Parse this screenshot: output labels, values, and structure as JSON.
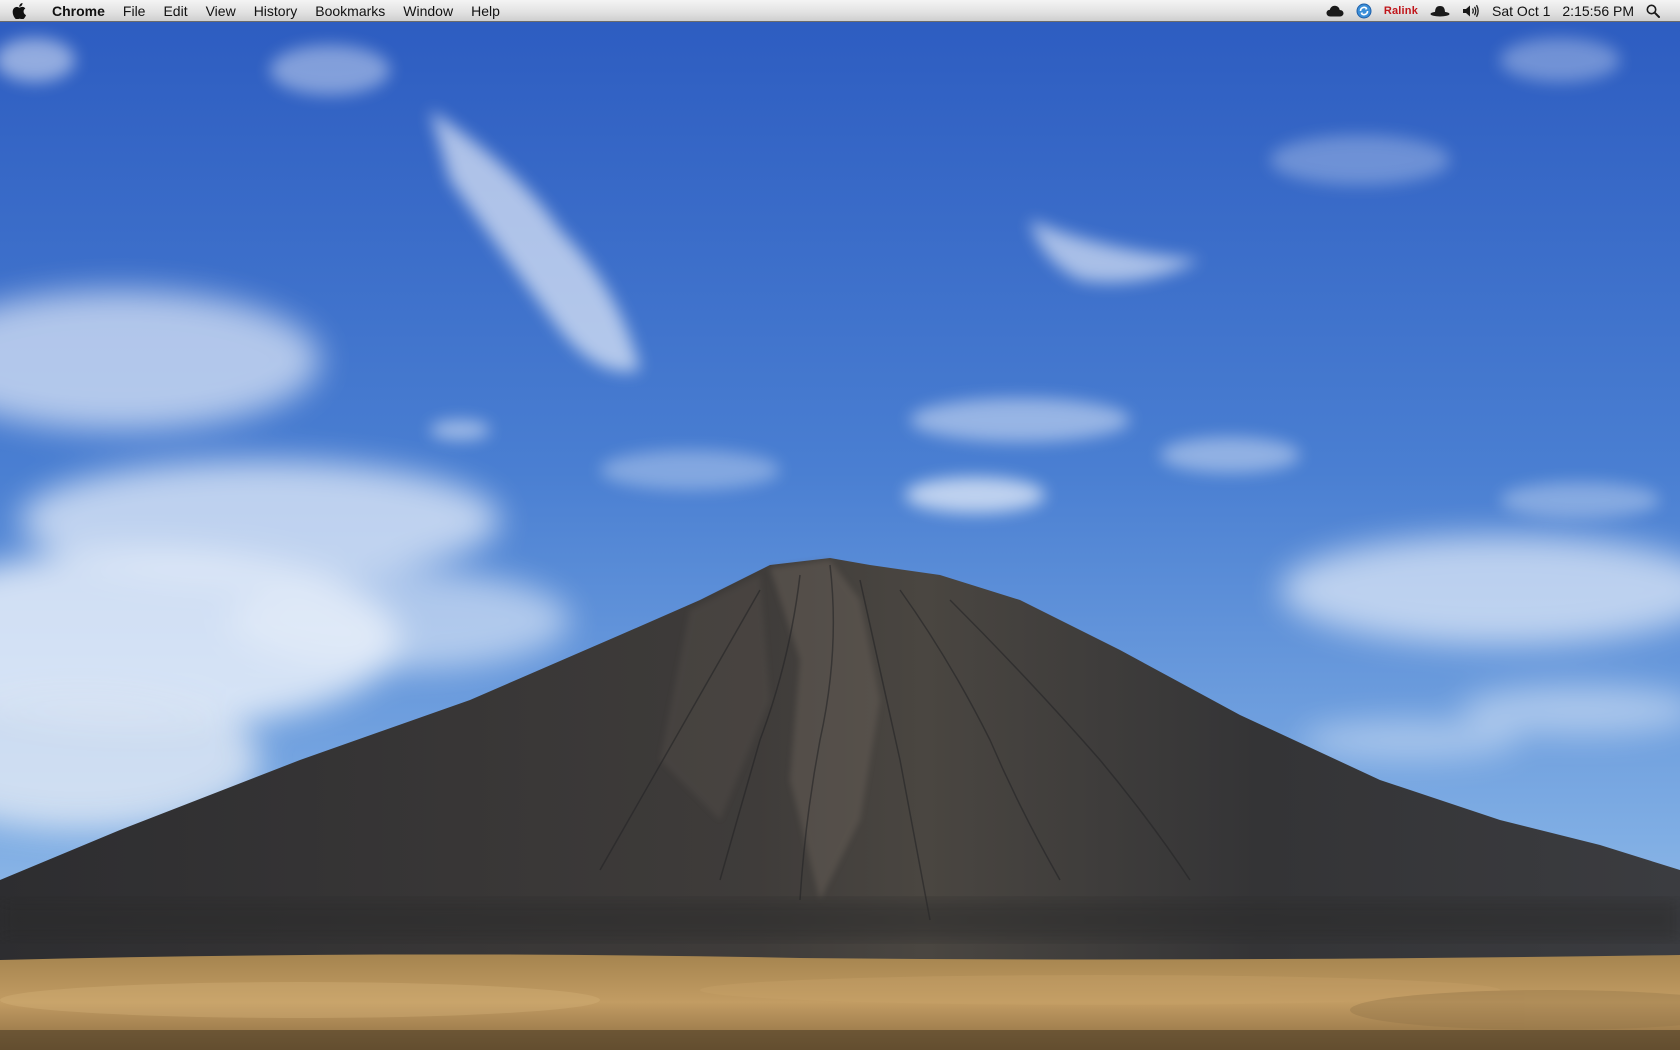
{
  "menubar": {
    "apple_icon": "apple-icon",
    "app_name": "Chrome",
    "menus": [
      "File",
      "Edit",
      "View",
      "History",
      "Bookmarks",
      "Window",
      "Help"
    ],
    "status": {
      "cloud_icon": "cloud-icon",
      "sync_icon": "sync-icon",
      "ralink_label": "Ralink",
      "hat_icon": "hat-icon",
      "volume_icon": "volume-icon",
      "date": "Sat Oct 1",
      "time": "2:15:56 PM",
      "spotlight_icon": "spotlight-search-icon"
    }
  },
  "colors": {
    "sky_top": "#2f5fc4",
    "sky_bottom": "#7aa6e0",
    "mountain": "#3b3b3d",
    "ground": "#b8925a",
    "ralink_red": "#c0151a"
  }
}
